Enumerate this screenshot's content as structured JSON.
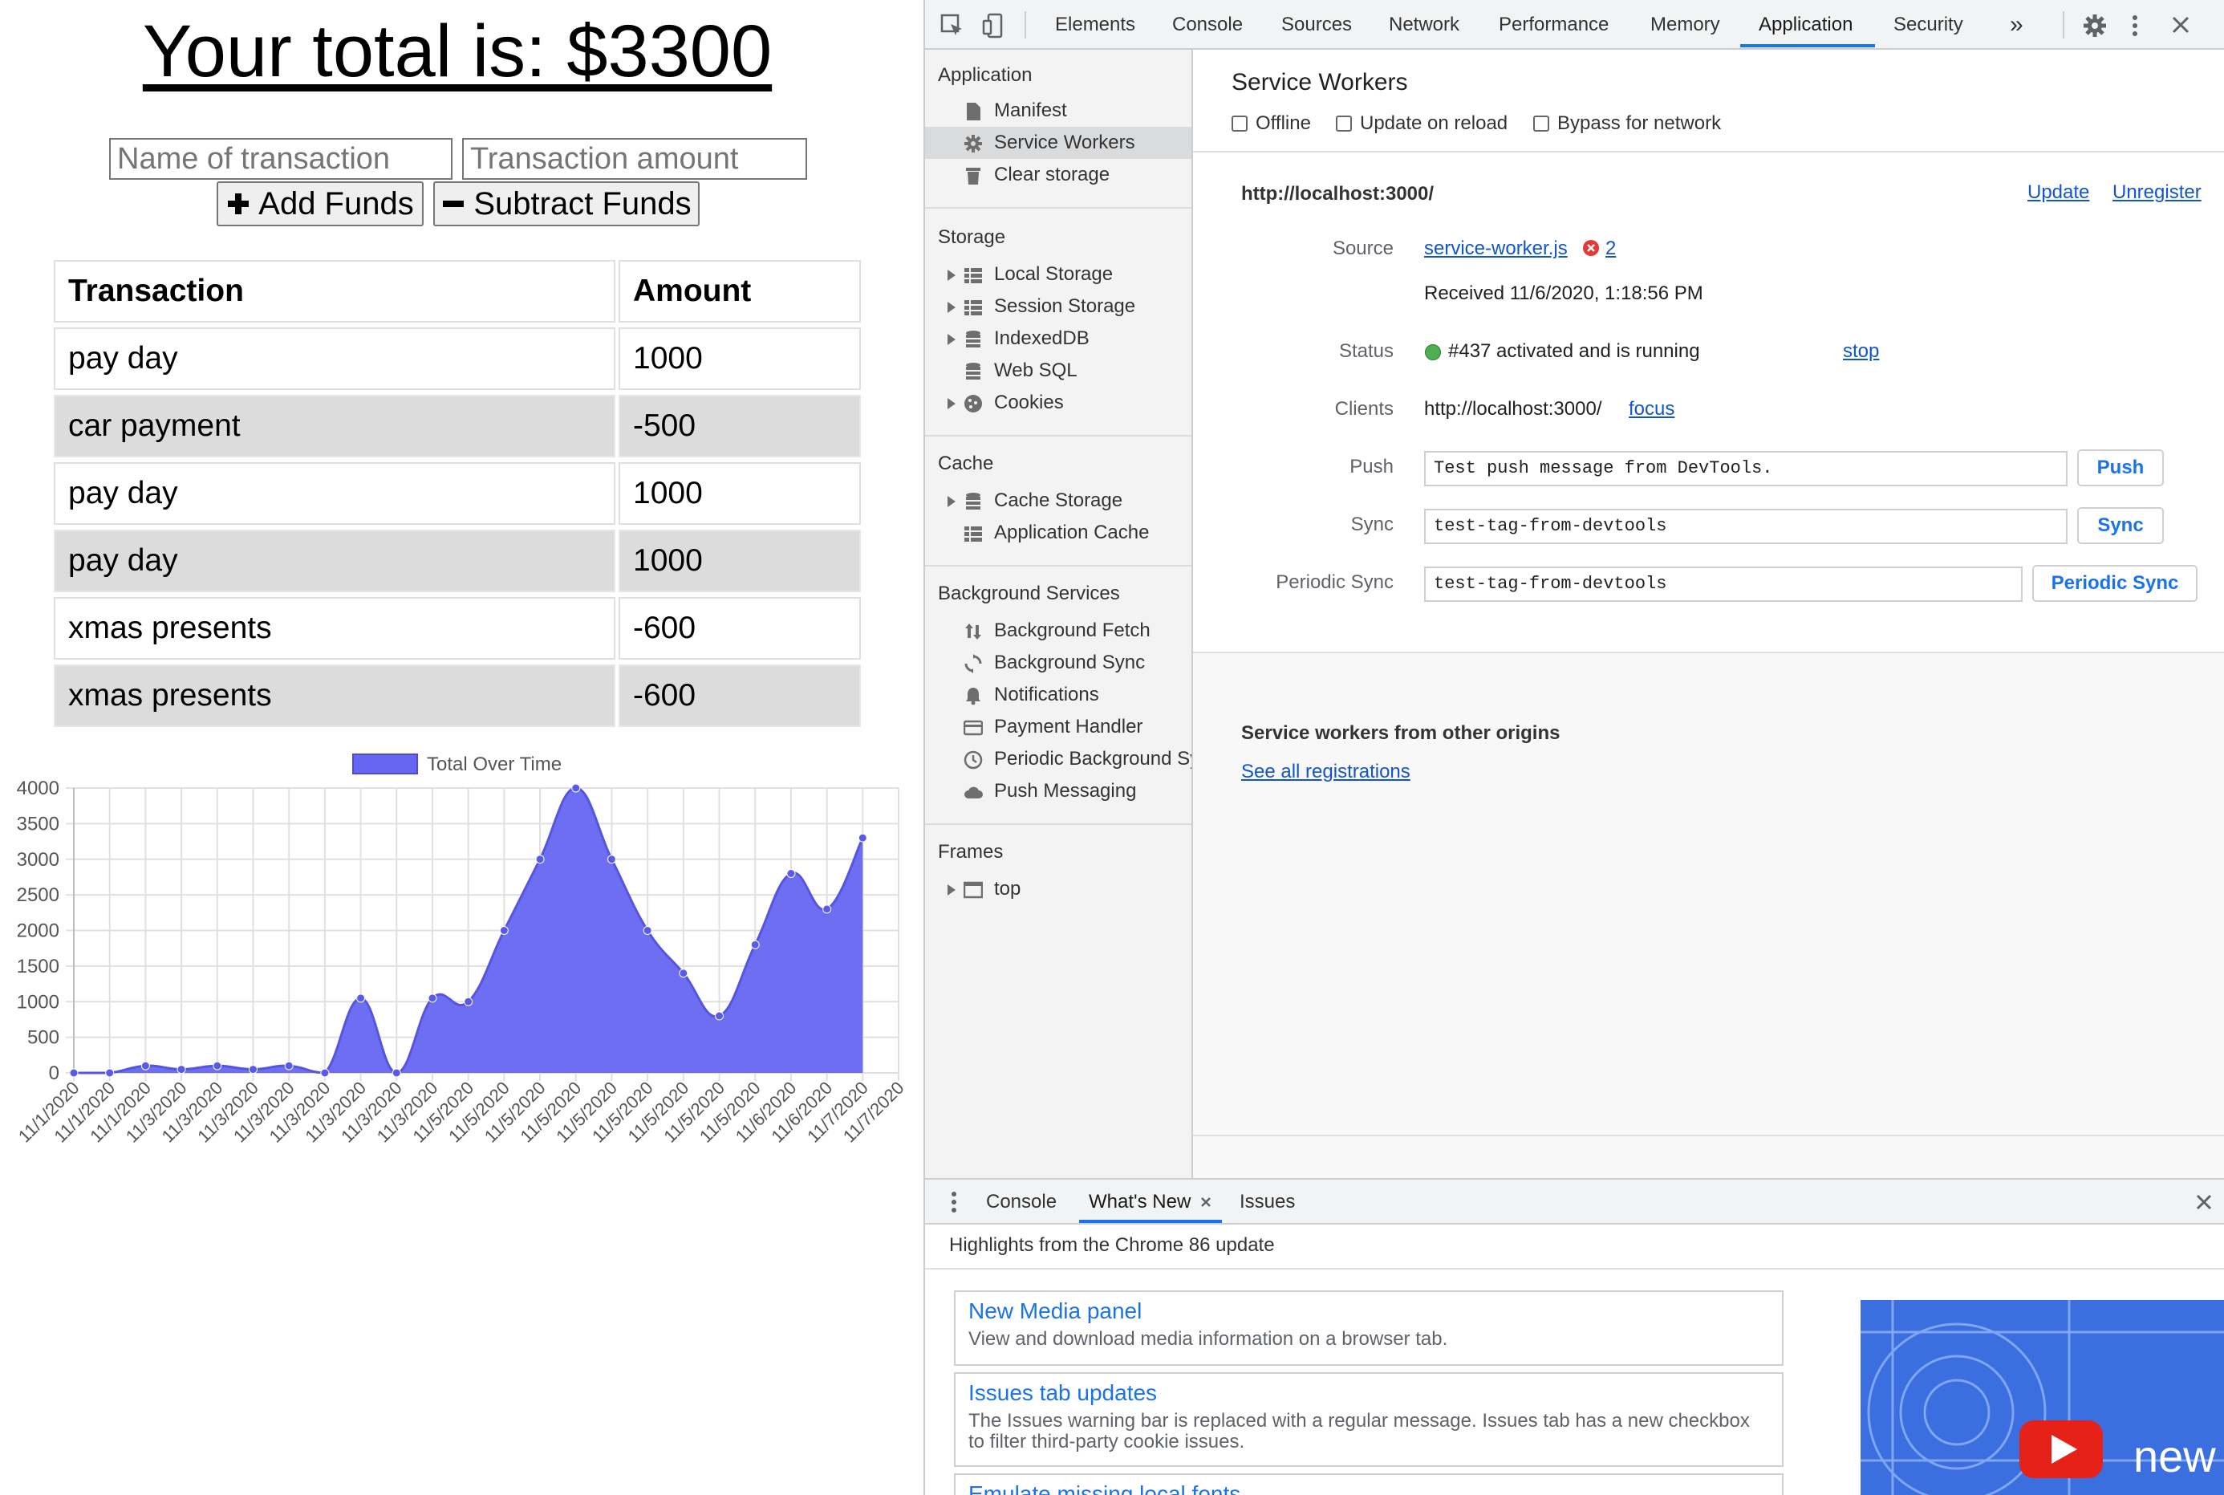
{
  "app": {
    "total_text": "Your total is: $3300",
    "name_placeholder": "Name of transaction",
    "amount_placeholder": "Transaction amount",
    "add_label": "Add Funds",
    "subtract_label": "Subtract Funds",
    "table": {
      "headers": [
        "Transaction",
        "Amount"
      ],
      "rows": [
        [
          "pay day",
          "1000"
        ],
        [
          "car payment",
          "-500"
        ],
        [
          "pay day",
          "1000"
        ],
        [
          "pay day",
          "1000"
        ],
        [
          "xmas presents",
          "-600"
        ],
        [
          "xmas presents",
          "-600"
        ]
      ]
    }
  },
  "chart_data": {
    "type": "area",
    "title": "",
    "legend": "top-center",
    "series": [
      {
        "name": "Total Over Time",
        "color": "#6666f2"
      }
    ],
    "x": [
      "11/1/2020",
      "11/1/2020",
      "11/1/2020",
      "11/3/2020",
      "11/3/2020",
      "11/3/2020",
      "11/3/2020",
      "11/3/2020",
      "11/3/2020",
      "11/3/2020",
      "11/3/2020",
      "11/5/2020",
      "11/5/2020",
      "11/5/2020",
      "11/5/2020",
      "11/5/2020",
      "11/5/2020",
      "11/5/2020",
      "11/5/2020",
      "11/5/2020",
      "11/6/2020",
      "11/6/2020",
      "11/7/2020",
      "11/7/2020"
    ],
    "values": [
      0,
      0,
      100,
      50,
      100,
      50,
      100,
      0,
      1050,
      0,
      1050,
      1000,
      2000,
      3000,
      4000,
      3000,
      2000,
      1400,
      800,
      1800,
      2800,
      2300,
      3300
    ],
    "ylim": [
      0,
      4000
    ],
    "yticks": [
      "0",
      "500",
      "1000",
      "1500",
      "2000",
      "2500",
      "3000",
      "3500",
      "4000"
    ],
    "grid": true
  },
  "devtools": {
    "tabs": [
      "Elements",
      "Console",
      "Sources",
      "Network",
      "Performance",
      "Memory",
      "Application",
      "Security"
    ],
    "more_tabs": "»",
    "active_tab": "Application",
    "sidebar": {
      "application_header": "Application",
      "application_items": [
        "Manifest",
        "Service Workers",
        "Clear storage"
      ],
      "storage_header": "Storage",
      "storage_items": [
        "Local Storage",
        "Session Storage",
        "IndexedDB",
        "Web SQL",
        "Cookies"
      ],
      "cache_header": "Cache",
      "cache_items": [
        "Cache Storage",
        "Application Cache"
      ],
      "bg_header": "Background Services",
      "bg_items": [
        "Background Fetch",
        "Background Sync",
        "Notifications",
        "Payment Handler",
        "Periodic Background Sync",
        "Push Messaging"
      ],
      "frames_header": "Frames",
      "frames_items": [
        "top"
      ]
    },
    "sw": {
      "title": "Service Workers",
      "opt_offline": "Offline",
      "opt_update": "Update on reload",
      "opt_bypass": "Bypass for network",
      "origin": "http://localhost:3000/",
      "update": "Update",
      "unregister": "Unregister",
      "source_label": "Source",
      "source_file": "service-worker.js",
      "error_count": "2",
      "received": "Received 11/6/2020, 1:18:56 PM",
      "status_label": "Status",
      "status_text": "#437 activated and is running",
      "stop": "stop",
      "clients_label": "Clients",
      "clients_url": "http://localhost:3000/",
      "focus": "focus",
      "push_label": "Push",
      "push_value": "Test push message from DevTools.",
      "push_btn": "Push",
      "sync_label": "Sync",
      "sync_value": "test-tag-from-devtools",
      "sync_btn": "Sync",
      "psync_label": "Periodic Sync",
      "psync_value": "test-tag-from-devtools",
      "psync_btn": "Periodic Sync",
      "other_title": "Service workers from other origins",
      "see_all": "See all registrations"
    },
    "drawer": {
      "tabs": [
        "Console",
        "What's New",
        "Issues"
      ],
      "active": "What's New",
      "highlights": "Highlights from the Chrome 86 update",
      "cards": [
        {
          "title": "New Media panel",
          "desc": "View and download media information on a browser tab."
        },
        {
          "title": "Issues tab updates",
          "desc": "The Issues warning bar is replaced with a regular message. Issues tab has a new checkbox to filter third-party cookie issues."
        },
        {
          "title": "Emulate missing local fonts",
          "desc": ""
        }
      ],
      "video_text": "new"
    }
  }
}
